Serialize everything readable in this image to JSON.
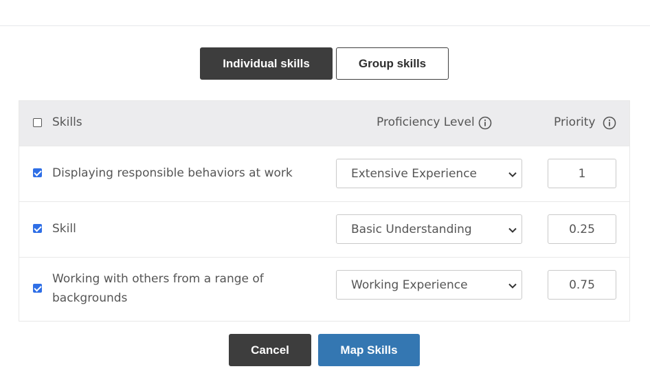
{
  "tabs": [
    {
      "label": "Individual skills",
      "active": true
    },
    {
      "label": "Group skills",
      "active": false
    }
  ],
  "table": {
    "headers": {
      "skills": "Skills",
      "proficiency": "Proficiency Level",
      "priority": "Priority"
    },
    "select_all_checked": false,
    "rows": [
      {
        "skill": "Displaying responsible behaviors at work",
        "checked": true,
        "proficiency": "Extensive Experience",
        "priority": "1"
      },
      {
        "skill": "Skill",
        "checked": true,
        "proficiency": "Basic Understanding",
        "priority": "0.25"
      },
      {
        "skill": "Working with others from a range of backgrounds",
        "checked": true,
        "proficiency": "Working Experience",
        "priority": "0.75"
      }
    ]
  },
  "actions": {
    "cancel_label": "Cancel",
    "map_label": "Map Skills"
  },
  "colors": {
    "primary_dark": "#3d3d3d",
    "accent_blue": "#3477b2",
    "checkbox_blue": "#2f6fe6",
    "header_bg": "#ececee"
  },
  "icons": {
    "header_info": "info-circle-icon",
    "select_caret": "chevron-down-icon"
  }
}
